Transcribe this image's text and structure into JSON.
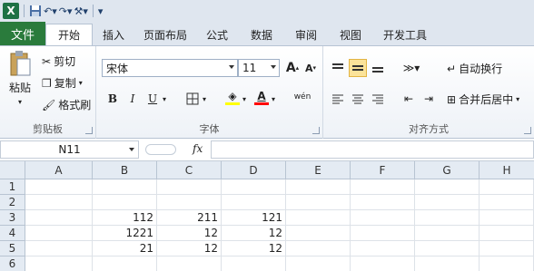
{
  "quick_access": {
    "icons": [
      "excel-logo",
      "save-icon",
      "undo-icon",
      "redo-icon",
      "customize-icon"
    ]
  },
  "tabs": [
    {
      "label": "文件"
    },
    {
      "label": "开始"
    },
    {
      "label": "插入"
    },
    {
      "label": "页面布局"
    },
    {
      "label": "公式"
    },
    {
      "label": "数据"
    },
    {
      "label": "审阅"
    },
    {
      "label": "视图"
    },
    {
      "label": "开发工具"
    }
  ],
  "clipboard": {
    "group_label": "剪贴板",
    "paste_label": "粘贴",
    "cut_label": "剪切",
    "copy_label": "复制",
    "format_painter_label": "格式刷"
  },
  "font": {
    "group_label": "字体",
    "font_name": "宋体",
    "font_size": "11",
    "bold": "B",
    "italic": "I",
    "underline": "U",
    "grow": "A",
    "shrink": "A",
    "font_color_letter": "A",
    "fill_color": "#ffff00",
    "font_color": "#ff0000",
    "wen_label": "wén"
  },
  "alignment": {
    "group_label": "对齐方式",
    "wrap_label": "自动换行",
    "merge_label": "合并后居中"
  },
  "formula_bar": {
    "name_box": "N11",
    "fx_label": "fx",
    "value": ""
  },
  "sheet": {
    "columns": [
      "A",
      "B",
      "C",
      "D",
      "E",
      "F",
      "G",
      "H"
    ],
    "rows": [
      "1",
      "2",
      "3",
      "4",
      "5",
      "6"
    ],
    "cells": {
      "B3": "112",
      "C3": "211",
      "D3": "121",
      "B4": "1221",
      "C4": "12",
      "D4": "12",
      "B5": "21",
      "C5": "12",
      "D5": "12"
    }
  }
}
